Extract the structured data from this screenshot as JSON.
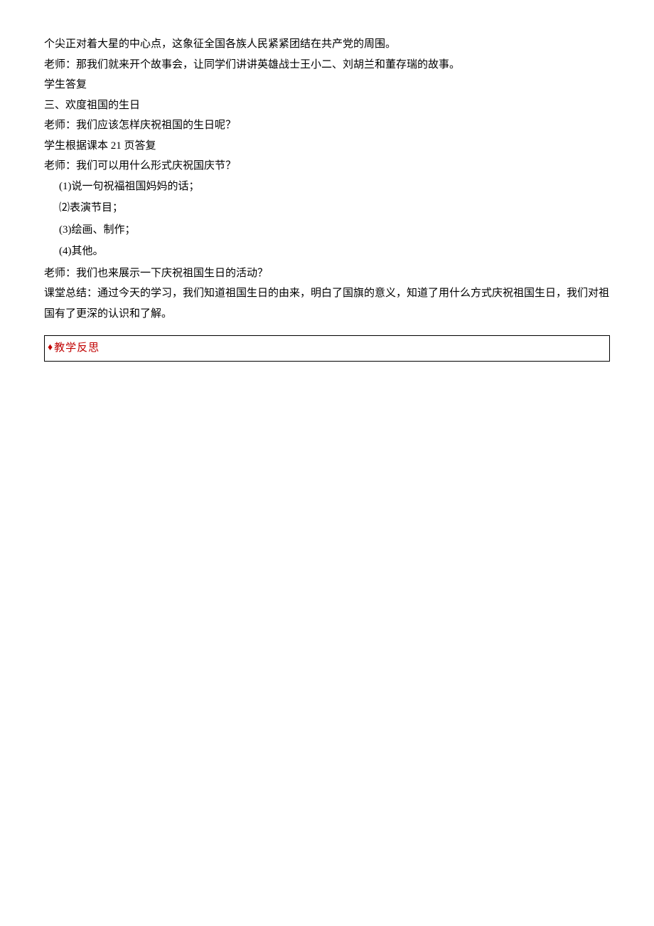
{
  "lines": {
    "l1": "个尖正对着大星的中心点，这象征全国各族人民紧紧团结在共产党的周围。",
    "l2": "老师：那我们就来开个故事会，让同学们讲讲英雄战士王小二、刘胡兰和董存瑞的故事。",
    "l3": "学生答复",
    "l4": "三、欢度祖国的生日",
    "l5": "老师：我们应该怎样庆祝祖国的生日呢？",
    "l6": "学生根据课本 21 页答复",
    "l7": "老师：我们可以用什么形式庆祝国庆节？",
    "sub1": "(1)说一句祝福祖国妈妈的话；",
    "sub2": "⑵表演节目；",
    "sub3": "(3)绘画、制作；",
    "sub4": "(4)其他。",
    "l8": "老师：我们也来展示一下庆祝祖国生日的活动？",
    "l9": "课堂总结：通过今天的学习，我们知道祖国生日的由来，明白了国旗的意义，知道了用什么方式庆祝祖国生日，我们对祖国有了更深的认识和了解。"
  },
  "section": {
    "diamond": "♦",
    "label": "教学反思"
  }
}
